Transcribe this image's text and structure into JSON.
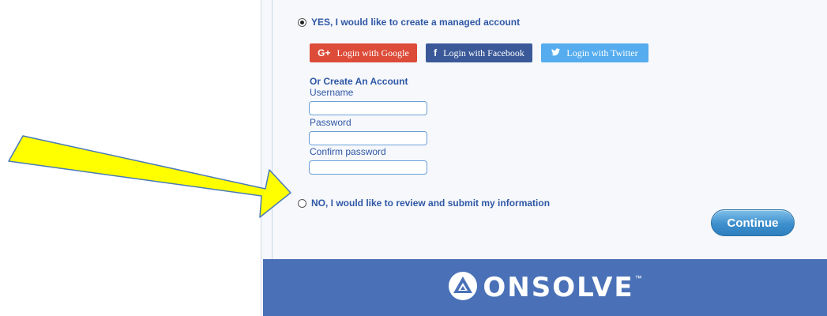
{
  "options": {
    "yes_label": "YES, I would like to create a managed account",
    "yes_selected": true,
    "no_label": "NO, I would like to review and submit my information",
    "no_selected": false
  },
  "social": {
    "google": {
      "icon": "G+",
      "label": "Login with Google"
    },
    "facebook": {
      "icon": "f",
      "label": "Login with Facebook"
    },
    "twitter": {
      "icon": "twitter-bird",
      "label": "Login with Twitter"
    }
  },
  "form": {
    "title": "Or Create An Account",
    "username_label": "Username",
    "username_value": "",
    "password_label": "Password",
    "password_value": "",
    "confirm_label": "Confirm password",
    "confirm_value": ""
  },
  "continue_label": "Continue",
  "footer": {
    "brand": "ONSOLVE",
    "trademark": "™"
  },
  "colors": {
    "accent_text": "#2f57a6",
    "google": "#dd4b39",
    "facebook": "#3b5998",
    "twitter": "#55acee",
    "footer": "#4a71b7",
    "arrow_fill": "#ffff00",
    "arrow_stroke": "#4a7ab8"
  }
}
